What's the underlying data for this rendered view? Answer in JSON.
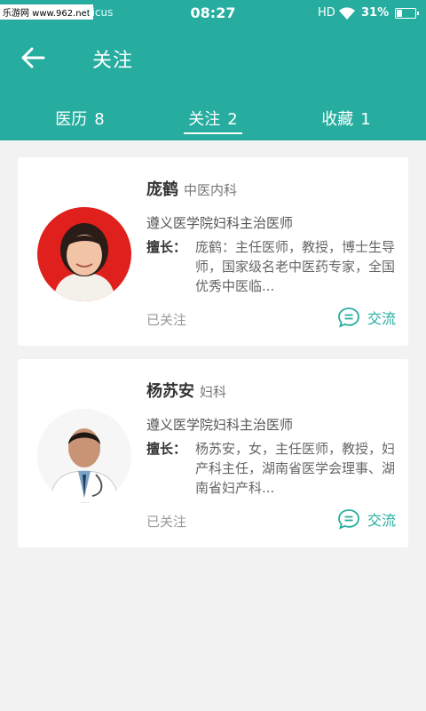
{
  "status_bar": {
    "watermark": "乐游网 www.962.net",
    "watermark_tail": "ificus",
    "time": "08:27",
    "network": "HD",
    "battery_text": "31%",
    "battery_level": 0.31
  },
  "header": {
    "title": "关注"
  },
  "tabs": [
    {
      "label": "医历",
      "count": "8",
      "active": false
    },
    {
      "label": "关注",
      "count": "2",
      "active": true
    },
    {
      "label": "收藏",
      "count": "1",
      "active": false
    }
  ],
  "doctors": [
    {
      "name": "庞鹤",
      "department": "中医内科",
      "hospital": "遵义医学院妇科主治医师",
      "specialty_label": "擅长：",
      "specialty": "庞鹤：主任医师，教授，博士生导师，国家级名老中医药专家，全国优秀中医临...",
      "followed": "已关注",
      "chat": "交流"
    },
    {
      "name": "杨苏安",
      "department": "妇科",
      "hospital": "遵义医学院妇科主治医师",
      "specialty_label": "擅长：",
      "specialty": "杨苏安，女，主任医师，教授，妇产科主任，湖南省医学会理事、湖南省妇产科...",
      "followed": "已关注",
      "chat": "交流"
    }
  ],
  "colors": {
    "primary": "#26ad9f",
    "background": "#f2f2f2"
  },
  "icons": {
    "back": "arrow-left-icon",
    "chat": "chat-bubble-icon",
    "wifi": "wifi-icon",
    "battery": "battery-icon"
  }
}
